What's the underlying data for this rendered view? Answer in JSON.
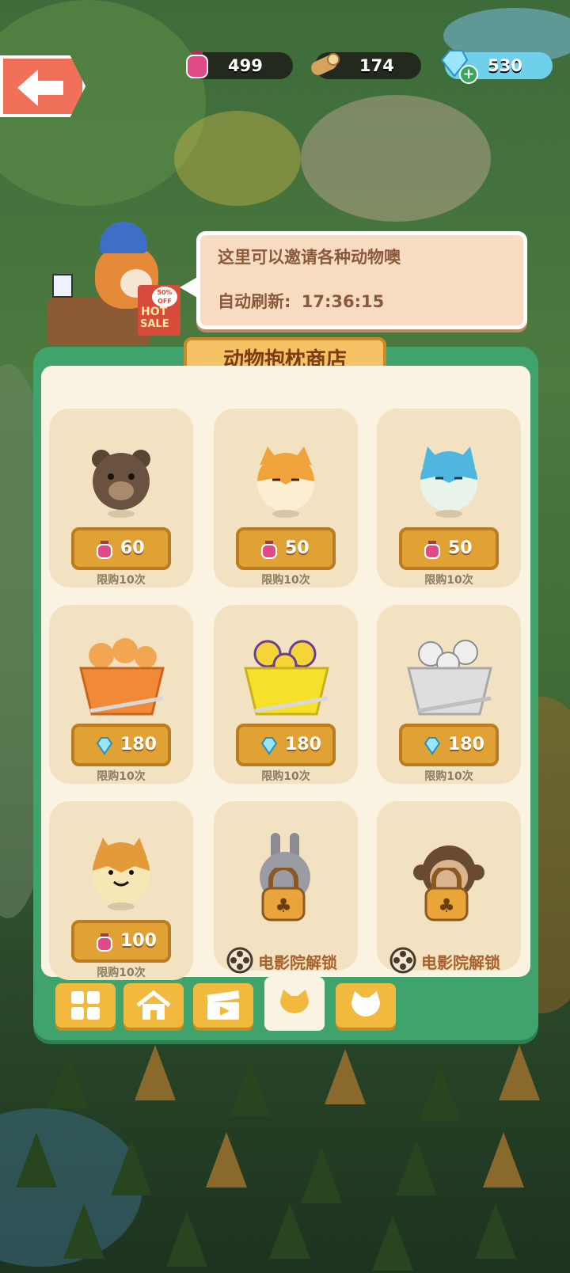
{
  "resources": {
    "potion": "499",
    "wood": "174",
    "gems": "530"
  },
  "bubble": {
    "line1": "这里可以邀请各种动物噢",
    "refresh_label": "自动刷新:",
    "refresh_time": "17:36:15"
  },
  "shop_title": "动物抱枕商店",
  "hot_sale": {
    "badge": "50% OFF",
    "line1": "HOT",
    "line2": "SALE"
  },
  "items": [
    {
      "name": "bear",
      "currency": "potion",
      "price": "60",
      "limit": "限购10次"
    },
    {
      "name": "shiba",
      "currency": "potion",
      "price": "50",
      "limit": "限购10次"
    },
    {
      "name": "blue-cat",
      "currency": "potion",
      "price": "50",
      "limit": "限购10次"
    },
    {
      "name": "orange-bag",
      "currency": "gem",
      "price": "180",
      "limit": "限购10次"
    },
    {
      "name": "yellow-bag",
      "currency": "gem",
      "price": "180",
      "limit": "限购10次"
    },
    {
      "name": "white-bag",
      "currency": "gem",
      "price": "180",
      "limit": "限购10次"
    },
    {
      "name": "dog-face",
      "currency": "potion",
      "price": "100",
      "limit": "限购10次"
    },
    {
      "name": "rabbit-locked",
      "unlock": "电影院解锁"
    },
    {
      "name": "monkey-locked",
      "unlock": "电影院解锁"
    }
  ],
  "tabs": [
    "grid-icon",
    "house-icon",
    "clapper-icon",
    "cat-head-icon",
    "cat-face-icon"
  ],
  "colors": {
    "panel": "#3fa36b",
    "card": "#f3e2c2",
    "price": "#e0a135",
    "potion": "#e04a86",
    "gem": "#7fd3f2"
  }
}
